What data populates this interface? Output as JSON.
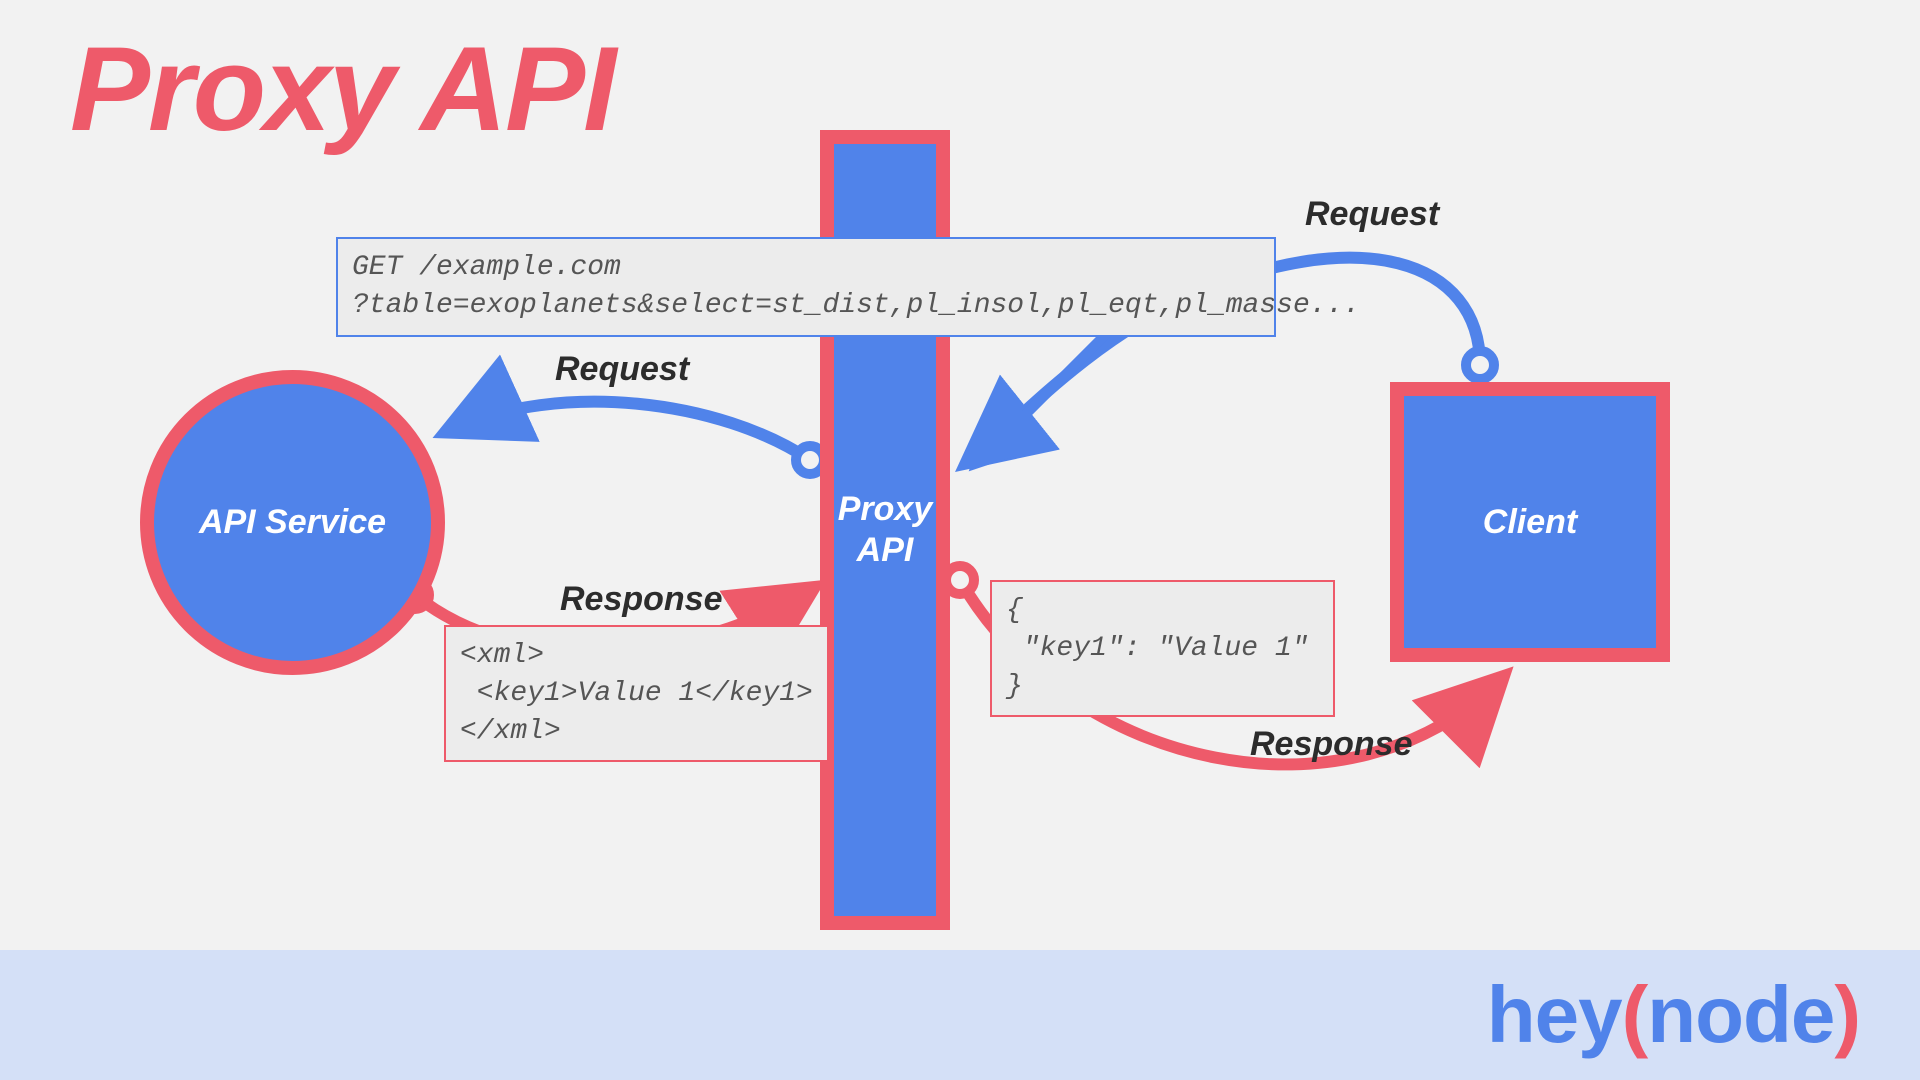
{
  "title": "Proxy API",
  "nodes": {
    "api_service": "API Service",
    "proxy_line1": "Proxy",
    "proxy_line2": "API",
    "client": "Client"
  },
  "arrows": {
    "client_to_proxy_request": "Request",
    "proxy_to_api_request": "Request",
    "api_to_proxy_response": "Response",
    "proxy_to_client_response": "Response"
  },
  "callouts": {
    "get_request": "GET /example.com\n?table=exoplanets&select=st_dist,pl_insol,pl_eqt,pl_masse...",
    "xml_response": "<xml>\n <key1>Value 1</key1>\n</xml>",
    "json_response": "{\n \"key1\": \"Value 1\"\n}"
  },
  "brand": {
    "hey": "hey",
    "open": "(",
    "node": "node",
    "close": ")"
  },
  "colors": {
    "blue": "#5083ea",
    "red": "#ee5a6a",
    "bg": "#f2f2f2",
    "footer": "#d4e0f7"
  }
}
